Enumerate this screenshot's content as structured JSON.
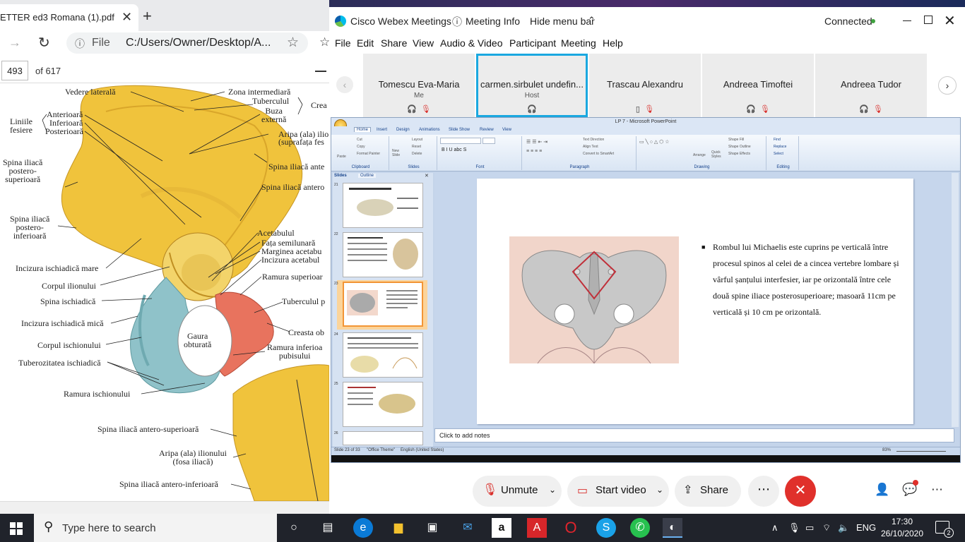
{
  "pdf_viewer": {
    "tab_title": "ETTER ed3 Romana (1).pdf",
    "file_label": "File",
    "url": "C:/Users/Owner/Desktop/A...",
    "page_number": "493",
    "page_total": "of 617",
    "labels": {
      "vedere": "Vedere laterală",
      "zona": "Zona intermediară",
      "tuberculul": "Tuberculul",
      "buza_externa": "Buza\nexternă",
      "crea": "Crea",
      "liniile_fesiere": "Liniile\nfesiere",
      "anterioara": "Anterioară",
      "inferioara": "Inferioară",
      "posterioara": "Posterioară",
      "aripa": "Aripa (ala) ilio",
      "suprafata": "(suprafața fes",
      "spina_ant_sup_top": "Spina iliacă ante",
      "spina_post_sup": "Spina iliacă\npostero-\nsuperioară",
      "spina_ant_inf_top": "Spina iliacă antero",
      "spina_post_inf": "Spina iliacă\npostero-\ninferioară",
      "acetabulul": "Acetabulul",
      "fata": "Fața semilunară",
      "marginea": "Marginea acetabu",
      "incizura_acet": "Incizura acetabul",
      "incizura_mare": "Incizura ischiadică mare",
      "ramura_sup": "Ramura superioar",
      "corpul_ilion": "Corpul ilionului",
      "spina_isch": "Spina ischiadică",
      "tuberculul_p": "Tuberculul p",
      "incizura_mica": "Incizura ischiadică mică",
      "creasta_ob": "Creasta ob",
      "gaura": "Gaura\nobturată",
      "corpul_isch": "Corpul ischionului",
      "ramura_inf": "Ramura inferioa\npubisului",
      "tuberozitatea": "Tuberozitatea ischiadică",
      "ramura_isch": "Ramura ischionului",
      "spina_ant_sup_b": "Spina iliacă antero-superioară",
      "aripa_fosa": "Aripa (ala) ilionului\n(fosa iliacă)",
      "spina_ant_inf_b": "Spina iliacă antero-inferioară"
    }
  },
  "webex": {
    "title": "Cisco Webex Meetings",
    "meeting_info": "Meeting Info",
    "hide_menu": "Hide menu bar",
    "status": "Connected",
    "menu": [
      "File",
      "Edit",
      "Share",
      "View",
      "Audio & Video",
      "Participant",
      "Meeting",
      "Help"
    ],
    "participants": [
      {
        "name": "Tomescu Eva-Maria",
        "role": "Me"
      },
      {
        "name": "carmen.sirbulet undefin...",
        "role": "Host"
      },
      {
        "name": "Trascau Alexandru",
        "role": ""
      },
      {
        "name": "Andreea Timoftei",
        "role": ""
      },
      {
        "name": "Andreea Tudor",
        "role": ""
      }
    ],
    "controls": {
      "unmute": "Unmute",
      "start_video": "Start video",
      "share": "Share"
    }
  },
  "powerpoint": {
    "title": "LP 7 - Microsoft PowerPoint",
    "tabs": [
      "Home",
      "Insert",
      "Design",
      "Animations",
      "Slide Show",
      "Review",
      "View"
    ],
    "groups": [
      "Clipboard",
      "Slides",
      "Font",
      "Paragraph",
      "Drawing",
      "Editing"
    ],
    "ribbon": {
      "paste": "Paste",
      "cut": "Cut",
      "copy": "Copy",
      "format_painter": "Format Painter",
      "new_slide": "New\nSlide",
      "layout": "Layout",
      "reset": "Reset",
      "delete": "Delete",
      "text_direction": "Text Direction",
      "align_text": "Align Text",
      "convert_smartart": "Convert to SmartArt",
      "arrange": "Arrange",
      "quick_styles": "Quick\nStyles",
      "shape_fill": "Shape Fill",
      "shape_outline": "Shape Outline",
      "shape_effects": "Shape Effects",
      "find": "Find",
      "replace": "Replace",
      "select": "Select"
    },
    "pane_tabs": [
      "Slides",
      "Outline"
    ],
    "thumbnails": [
      "21",
      "22",
      "23",
      "24",
      "25",
      "26"
    ],
    "slide_text": "Rombul lui Michaelis este cuprins pe verticală între procesul spinos al celei de a cincea vertebre lombare și vârful șanțului interfesier, iar pe orizontală între cele două spine iliace posterosuperioare; masoară 11cm pe verticală și 10 cm pe orizontală.",
    "notes_placeholder": "Click to add notes",
    "status": {
      "slide": "Slide 23 of 33",
      "theme": "\"Office Theme\"",
      "language": "English (United States)",
      "zoom": "83%"
    }
  },
  "taskbar": {
    "search_placeholder": "Type here to search",
    "language": "ENG",
    "time": "17:30",
    "date": "26/10/2020",
    "notification_count": "2"
  }
}
